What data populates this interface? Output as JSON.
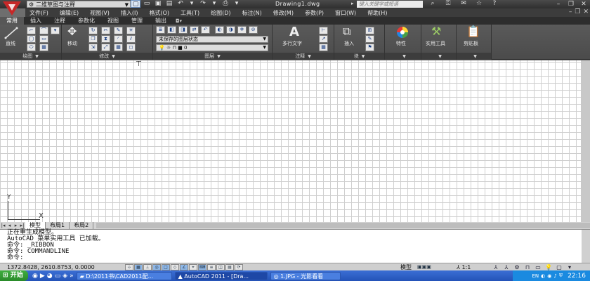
{
  "titlebar": {
    "workspace": "二维草图与注释",
    "document_title": "Drawing1.dwg",
    "search_placeholder": "键入关键字或短语"
  },
  "menubar": {
    "items": [
      "文件(F)",
      "编辑(E)",
      "视图(V)",
      "插入(I)",
      "格式(O)",
      "工具(T)",
      "绘图(D)",
      "标注(N)",
      "修改(M)",
      "参数(P)",
      "窗口(W)",
      "帮助(H)"
    ]
  },
  "ribbon_tabs": {
    "items": [
      "常用",
      "插入",
      "注释",
      "参数化",
      "视图",
      "管理",
      "输出"
    ],
    "active": "常用"
  },
  "ribbon": {
    "panels": {
      "draw": "绘图",
      "modify": "修改",
      "layers": "图层",
      "annotation": "注释",
      "block": "块",
      "properties_title": "",
      "utilities_title": "",
      "clipboard_title": ""
    },
    "line_label": "直线",
    "move_label": "移动",
    "layer_state": "未保存的图层状态",
    "layer_current": "0",
    "mtext_label": "多行文字",
    "insert_label": "插入",
    "properties_label": "特性",
    "utilities_label": "实用工具",
    "clipboard_label": "剪贴板"
  },
  "layout_tabs": {
    "items": [
      "模型",
      "布局1",
      "布局2"
    ],
    "active": "模型"
  },
  "command_window": {
    "lines": [
      "正在重生成模型。",
      "AutoCAD 菜单实用工具 已加载。",
      "命令: _RIBBON",
      "命令: COMMANDLINE",
      "命令:"
    ]
  },
  "statusbar": {
    "coordinates": "1372.8428, 2610.8753, 0.0000",
    "model_label": "模型",
    "annotation_scale": "1:1"
  },
  "taskbar": {
    "start_label": "开始",
    "buttons": [
      "D:\\2011书\\CAD2011配...",
      "AutoCAD 2011 - [Dra...",
      "1.JPG - 光影看看"
    ],
    "active_index": 1,
    "clock": "22:16",
    "language": "EN"
  },
  "ucs": {
    "x_label": "X",
    "y_label": "Y"
  }
}
